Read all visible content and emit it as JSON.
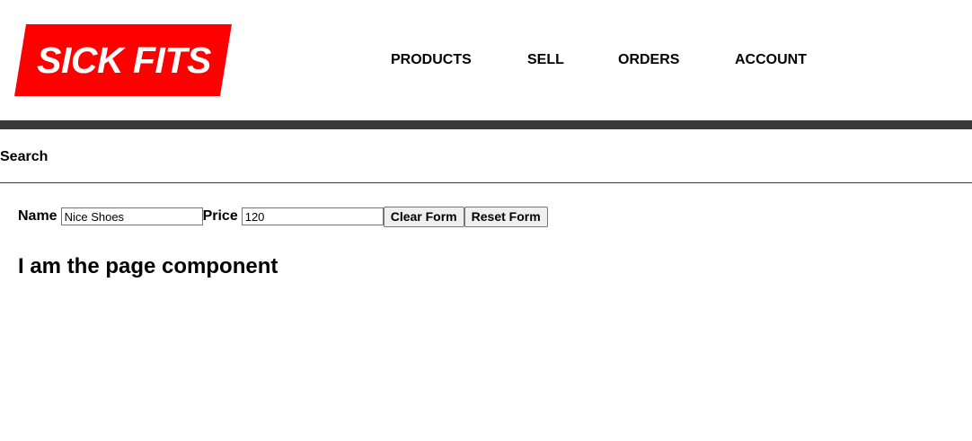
{
  "header": {
    "logo_text": "SICK FITS",
    "brand_color": "#ff0000",
    "nav": [
      {
        "label": "PRODUCTS"
      },
      {
        "label": "SELL"
      },
      {
        "label": "ORDERS"
      },
      {
        "label": "ACCOUNT"
      }
    ],
    "bar_color": "#393939"
  },
  "subbar": {
    "search_label": "Search"
  },
  "form": {
    "name_label": "Name",
    "name_value": "Nice Shoes",
    "price_label": "Price",
    "price_value": "120",
    "clear_button": "Clear Form",
    "reset_button": "Reset Form"
  },
  "main": {
    "heading": "I am the page component"
  }
}
